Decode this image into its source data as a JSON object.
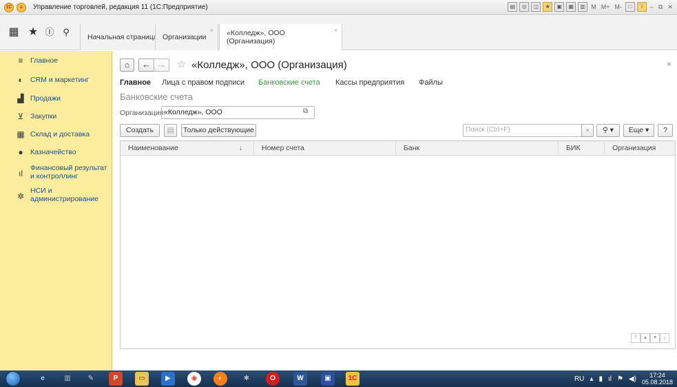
{
  "window": {
    "title": "Управление торговлей, редакция 11 (1С:Предприятие)",
    "toolbar_text": [
      "M",
      "M+",
      "M-"
    ]
  },
  "tabs": [
    {
      "label": "Начальная страница"
    },
    {
      "label": "Организации"
    },
    {
      "label": "«Колледж», ООО (Организация)"
    }
  ],
  "sidebar": {
    "items": [
      {
        "label": "Главное",
        "icon": "menu-lines-icon"
      },
      {
        "label": "CRM и маркетинг",
        "icon": "crm-icon"
      },
      {
        "label": "Продажи",
        "icon": "bag-icon"
      },
      {
        "label": "Закупки",
        "icon": "cart-icon"
      },
      {
        "label": "Склад и доставка",
        "icon": "warehouse-icon"
      },
      {
        "label": "Казначейство",
        "icon": "treasury-icon"
      },
      {
        "label": "Финансовый результат и контроллинг",
        "icon": "chart-bars-icon"
      },
      {
        "label": "НСИ и администрирование",
        "icon": "gear-icon"
      }
    ]
  },
  "form": {
    "title": "«Колледж», ООО (Организация)",
    "links": [
      "Главное",
      "Лица с правом подписи",
      "Банковские счета",
      "Кассы предприятия",
      "Файлы"
    ],
    "section_title": "Банковские счета",
    "org_label": "Организация:",
    "org_value": "«Колледж», ООО",
    "buttons": {
      "create": "Создать",
      "only_active": "Только действующие",
      "more": "Еще",
      "help": "?"
    },
    "search_placeholder": "Поиск (Ctrl+F)",
    "columns": [
      "Наименование",
      "Номер счета",
      "Банк",
      "БИК",
      "Организация"
    ]
  },
  "taskbar": {
    "lang": "RU",
    "time": "17:24",
    "date": "05.08.2018",
    "apps": [
      "ie",
      "calc",
      "paint",
      "powerpoint",
      "folder",
      "media",
      "chrome",
      "firefox",
      "tools",
      "opera",
      "word",
      "save",
      "1c"
    ]
  }
}
